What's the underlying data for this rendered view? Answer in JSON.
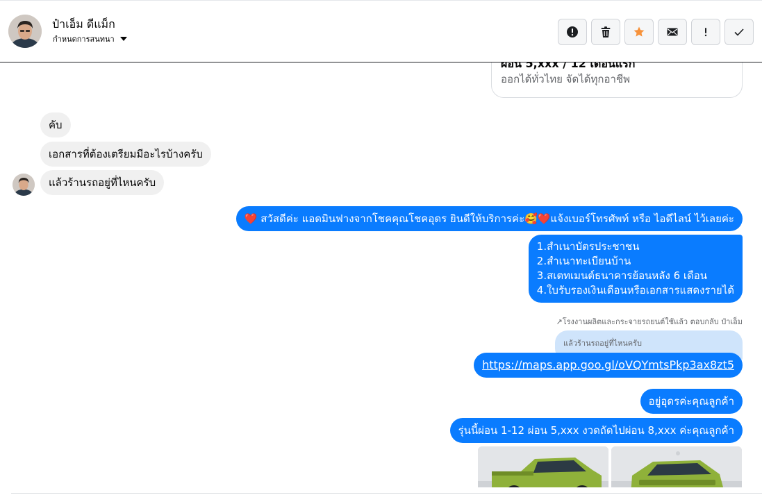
{
  "header": {
    "contact_name": "ป๋าเอ็ม ดีแม็ก",
    "conversation_label": "กำหนดการสนทนา",
    "actions": [
      {
        "name": "alert-circle",
        "icon": "exclamation-circle-icon"
      },
      {
        "name": "delete",
        "icon": "trash-icon"
      },
      {
        "name": "star",
        "icon": "star-icon"
      },
      {
        "name": "mail",
        "icon": "envelope-icon"
      },
      {
        "name": "spam",
        "icon": "exclamation-icon"
      },
      {
        "name": "done",
        "icon": "check-icon"
      }
    ]
  },
  "colors": {
    "outgoing": "#0a7cff",
    "incoming": "#f0f0f0",
    "star": "#f7923a",
    "quote": "#cfe4fb"
  },
  "card_fragment": {
    "line1": "ผ่อน 5,xxx / 12 เดือนแรก",
    "line2": "ออกได้ทั่วไทย จัดได้ทุกอาชีพ"
  },
  "messages": {
    "in1": "คับ",
    "in2": "เอกสารที่ต้องเตรียมมีอะไรบ้างครับ",
    "in3": "แล้วร้านรถอยู่ที่ไหนครับ",
    "out1": "❤️ สวัสดีค่ะ แอดมินฟางจากโชคคุณโชคอุดร ยินดีให้บริการค่ะ🥰❤️แจ้งเบอร์โทรศัพท์ หรือ ไอดีไลน์  ไว้เลยค่ะ",
    "out2_lines": [
      "1.สำเนาบัตรประชาชน",
      "2.สำเนาทะเบียนบ้าน",
      "3.สเตทเมนต์ธนาคารย้อนหลัง 6 เดือน",
      "4.ใบรับรองเงินเดือนหรือเอกสารแสดงรายได้"
    ],
    "reply_note": "↗โรงงานผลิตและกระจายรถยนต์ใช้แล้ว ตอบกลับ ป๋าเอ็ม",
    "reply_quote": "แล้วร้านรถอยู่ที่ไหนครับ",
    "out3_link": "https://maps.app.goo.gl/oVQYmtsPkp3ax8zt5",
    "out4": "อยู่อุดรค่ะคุณลูกค้า",
    "out5": "รุ่นนี้ผ่อน 1-12 ผ่อน 5,xxx งวดถัดไปผ่อน 8,xxx ค่ะคุณลูกค้า"
  }
}
